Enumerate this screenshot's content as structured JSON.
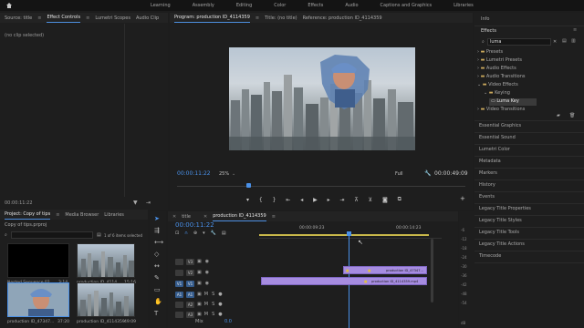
{
  "topbar": {
    "workspaces": [
      "Learning",
      "Assembly",
      "Editing",
      "Color",
      "Effects",
      "Audio",
      "Captions and Graphics",
      "Libraries"
    ]
  },
  "source_panel": {
    "tabs": [
      "Source: title",
      "Effect Controls",
      "Lumetri Scopes",
      "Audio Clip"
    ],
    "no_clip": "(no clip selected)",
    "timecode": "00:00:11:22"
  },
  "program_panel": {
    "tabs": [
      "Program: production ID_4114359",
      "Title: (no title)",
      "Reference: production ID_4114359"
    ],
    "timecode": "00:00:11:22",
    "zoom": "25%",
    "quality": "Full",
    "duration": "00:00:49:09"
  },
  "effects_panel": {
    "info_tab": "Info",
    "title": "Effects",
    "search_value": "luma",
    "tree": [
      {
        "label": "Presets",
        "indent": 0
      },
      {
        "label": "Lumetri Presets",
        "indent": 0
      },
      {
        "label": "Audio Effects",
        "indent": 0
      },
      {
        "label": "Audio Transitions",
        "indent": 0
      },
      {
        "label": "Video Effects",
        "indent": 0
      },
      {
        "label": "Keying",
        "indent": 1
      },
      {
        "label": "Luma Key",
        "indent": 2
      },
      {
        "label": "Video Transitions",
        "indent": 0
      }
    ],
    "side_panels": [
      "Essential Graphics",
      "Essential Sound",
      "Lumetri Color",
      "Metadata",
      "Markers",
      "History",
      "Events",
      "Legacy Title Properties",
      "Legacy Title Styles",
      "Legacy Title Tools",
      "Legacy Title Actions",
      "Timecode"
    ]
  },
  "project_panel": {
    "tabs": [
      "Project: Copy of tips",
      "Media Browser",
      "Libraries"
    ],
    "file": "Copy of tips.prproj",
    "items_count": "1 of 6 items selected",
    "thumbs": [
      {
        "name": "Nested Sequence 02",
        "duration": "3:14"
      },
      {
        "name": "production ID_4114...",
        "duration": "15:16"
      },
      {
        "name": "production ID_47347...",
        "duration": "37:20"
      },
      {
        "name": "production ID_4114359",
        "duration": "49:09"
      }
    ]
  },
  "timeline": {
    "tabs": [
      "title",
      "production ID_4114359"
    ],
    "timecode": "00:00:11:22",
    "ruler": [
      "00:00:09:23",
      "00:00:14:23"
    ],
    "video_tracks": [
      "V3",
      "V2",
      "V1"
    ],
    "audio_tracks": [
      "A1",
      "A2",
      "A3"
    ],
    "mix_label": "Mix",
    "mix_value": "0.0",
    "clips": [
      {
        "label": "production ID_47347...",
        "track": "V2"
      },
      {
        "label": "production ID_4114359.mp4",
        "track": "V1"
      }
    ],
    "meter_ticks": [
      "-6",
      "-12",
      "-18",
      "-24",
      "-30",
      "-36",
      "-42",
      "-48",
      "-54",
      "dB"
    ]
  }
}
